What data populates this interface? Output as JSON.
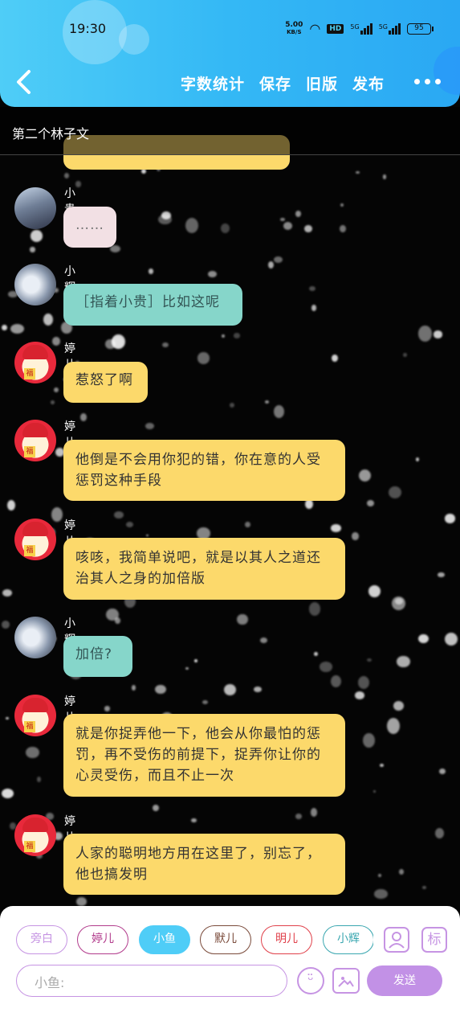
{
  "status_bar": {
    "time": "19:30",
    "net_speed": "5.00",
    "net_unit": "KB/S",
    "hd": "HD",
    "sim1": "5G",
    "sim2": "5G",
    "battery": "95"
  },
  "header": {
    "back_icon": "chevron-left-icon",
    "actions": [
      "字数统计",
      "保存",
      "旧版",
      "发布"
    ],
    "more_icon": "more-dots-icon"
  },
  "doc_title": "第二个林子文",
  "messages": [
    {
      "name": "小贵",
      "text": "……",
      "style": "pink"
    },
    {
      "name": "小辉",
      "text": "［指着小贵］比如这呢",
      "style": "teal"
    },
    {
      "name": "婷儿",
      "text": "惹怒了啊",
      "style": "yellow"
    },
    {
      "name": "婷儿",
      "text": "他倒是不会用你犯的错，你在意的人受惩罚这种手段",
      "style": "yellow"
    },
    {
      "name": "婷儿",
      "text": "咳咳，我简单说吧，就是以其人之道还治其人之身的加倍版",
      "style": "yellow"
    },
    {
      "name": "小辉",
      "text": "加倍?",
      "style": "teal"
    },
    {
      "name": "婷儿",
      "text": "就是你捉弄他一下，他会从你最怕的惩罚，再不受伤的前提下，捉弄你让你的心灵受伤，而且不止一次",
      "style": "yellow"
    },
    {
      "name": "婷儿",
      "text": "人家的聪明地方用在这里了，别忘了，他也搞发明",
      "style": "yellow"
    }
  ],
  "composer": {
    "roles": [
      {
        "label": "旁白",
        "color": "#c694e3",
        "selected": false
      },
      {
        "label": "婷儿",
        "color": "#b23b8c",
        "selected": false
      },
      {
        "label": "小鱼",
        "color": "#4fcdf7",
        "selected": true
      },
      {
        "label": "默儿",
        "color": "#7a4a3a",
        "selected": false
      },
      {
        "label": "明儿",
        "color": "#e0404a",
        "selected": false
      },
      {
        "label": "小辉",
        "color": "#3aa7b0",
        "selected": false
      }
    ],
    "role_icon": "person-icon",
    "tag_icon": "标",
    "input_placeholder": "小鱼:",
    "emoji_icon": "emoji-icon",
    "image_icon": "image-icon",
    "send_label": "发送"
  }
}
